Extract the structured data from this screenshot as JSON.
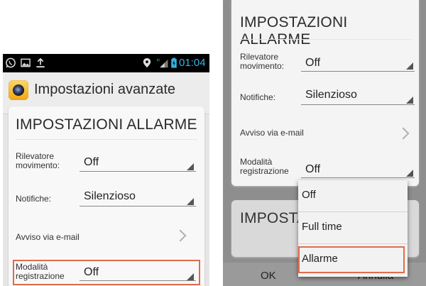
{
  "left": {
    "status_bar": {
      "time": "01:04"
    },
    "action_bar": {
      "title": "Impostazioni avanzate"
    },
    "section_title": "IMPOSTAZIONI ALLARME",
    "motion_detector": {
      "label": "Rilevatore movimento:",
      "value": "Off"
    },
    "notifications": {
      "label": "Notifiche:",
      "value": "Silenzioso"
    },
    "email_alert": {
      "label": "Avviso via e-mail"
    },
    "recording_mode": {
      "label": "Modalità registrazione",
      "value": "Off"
    }
  },
  "right": {
    "section_title": "IMPOSTAZIONI ALLARME",
    "motion_detector": {
      "label": "Rilevatore movimento:",
      "value": "Off"
    },
    "notifications": {
      "label": "Notifiche:",
      "value": "Silenzioso"
    },
    "email_alert": {
      "label": "Avviso via e-mail"
    },
    "recording_mode": {
      "label": "Modalità registrazione",
      "value": "Off"
    },
    "second_section_title": "IMPOSTAZ",
    "dropdown_options": [
      "Off",
      "Full time",
      "Allarme"
    ],
    "ok_label": "OK",
    "cancel_label": "Annulla"
  },
  "colors": {
    "highlight": "#e06c4c",
    "status_bar_bg": "#000000",
    "time_color": "#33b5e5"
  }
}
